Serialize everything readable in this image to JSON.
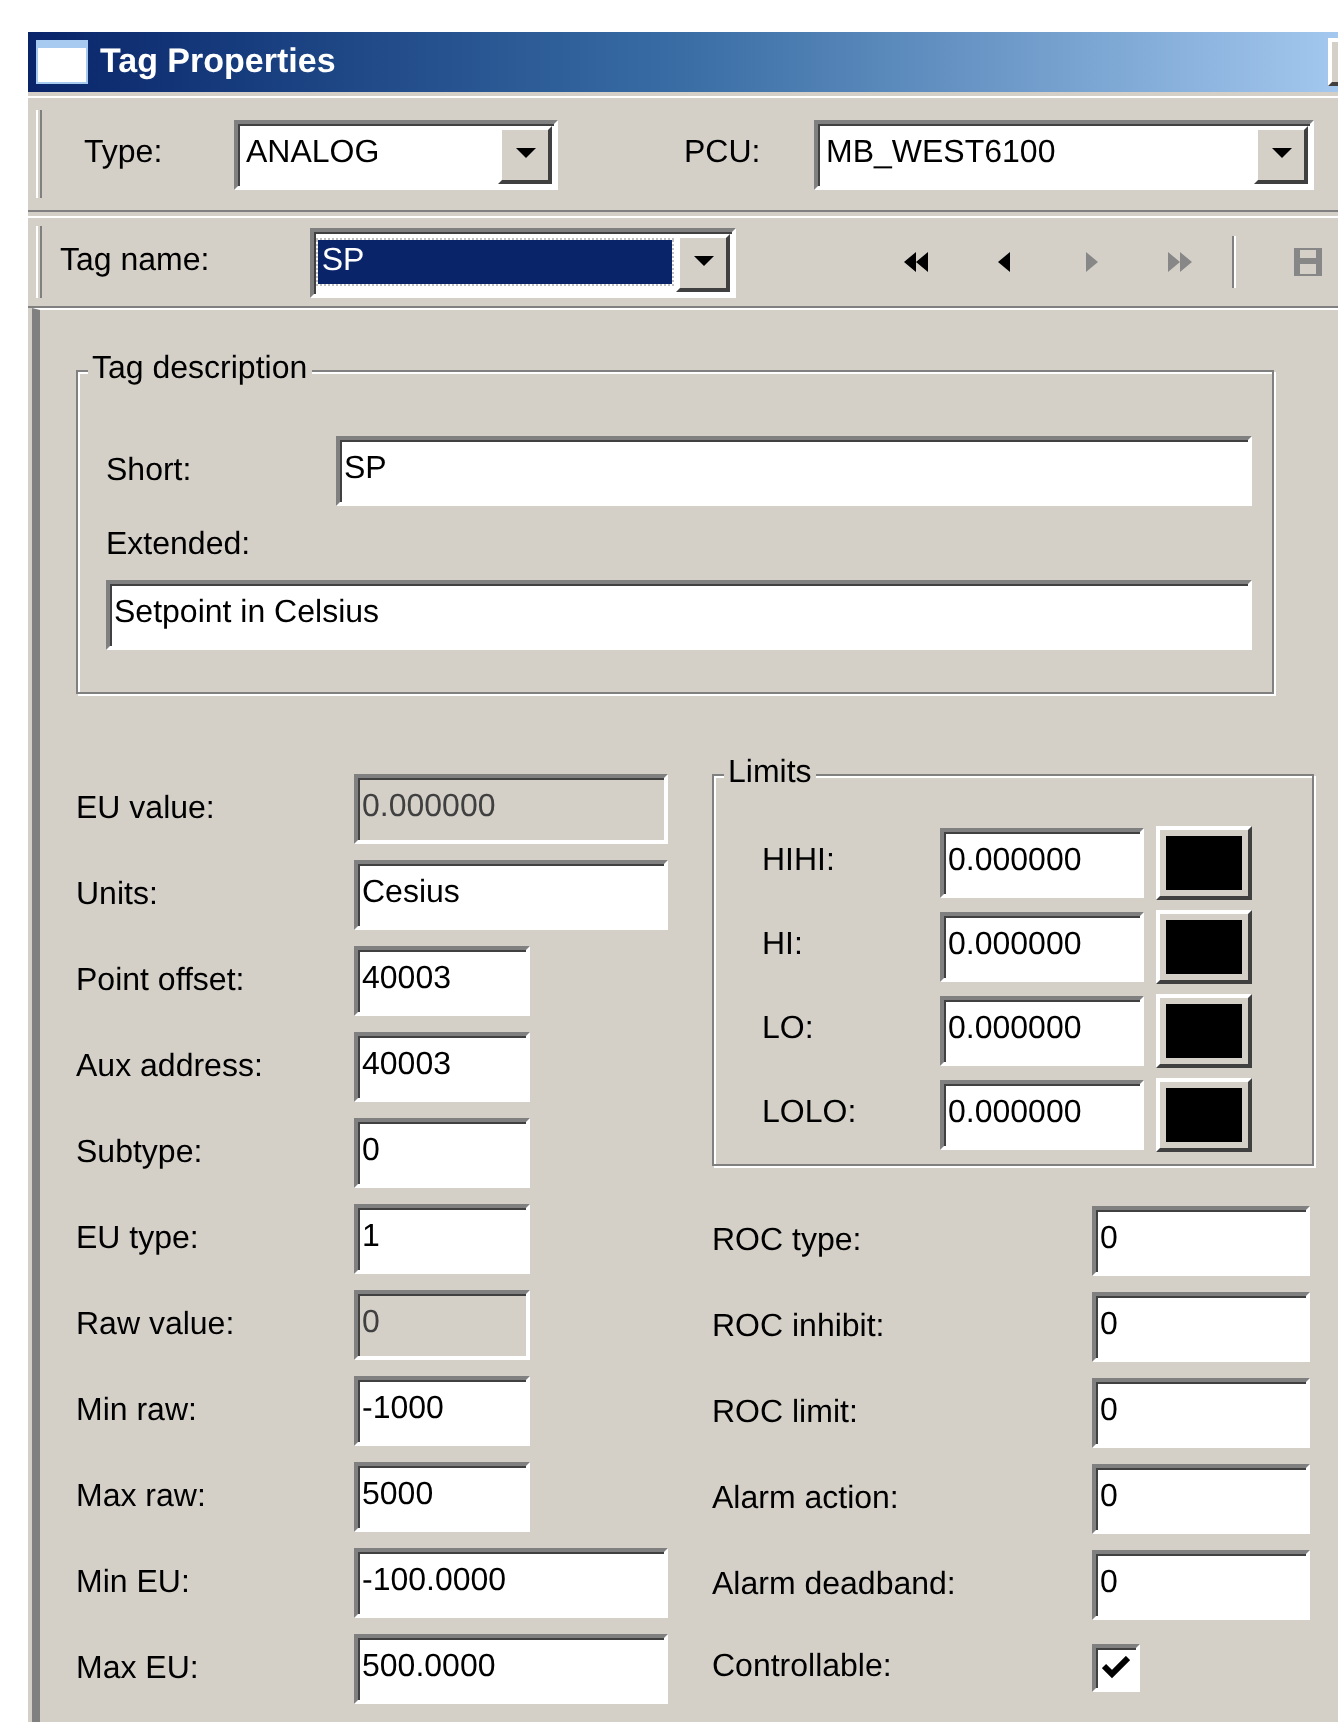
{
  "window": {
    "title": "Tag Properties"
  },
  "toolbar": {
    "type": {
      "label": "Type:",
      "value": "ANALOG"
    },
    "pcu": {
      "label": "PCU:",
      "value": "MB_WEST6100"
    }
  },
  "tag_bar": {
    "label": "Tag name:",
    "value": "SP",
    "nav": [
      {
        "kind": "first",
        "disabled": false
      },
      {
        "kind": "previous",
        "disabled": false
      },
      {
        "kind": "next",
        "disabled": true
      },
      {
        "kind": "last",
        "disabled": true
      },
      {
        "kind": "save",
        "disabled": true
      }
    ]
  },
  "tag_description": {
    "title": "Tag description",
    "short": {
      "label": "Short:",
      "value": "SP"
    },
    "extended": {
      "label": "Extended:",
      "value": "Setpoint in Celsius"
    }
  },
  "fields": [
    {
      "label": "EU value:",
      "value": "0.000000",
      "kind": "wide",
      "disabled": true
    },
    {
      "label": "Units:",
      "value": "Cesius",
      "kind": "wide",
      "disabled": false
    },
    {
      "label": "Point offset:",
      "value": "40003",
      "kind": "narrow",
      "disabled": false
    },
    {
      "label": "Aux address:",
      "value": "40003",
      "kind": "narrow",
      "disabled": false
    },
    {
      "label": "Subtype:",
      "value": "0",
      "kind": "narrow",
      "disabled": false
    },
    {
      "label": "EU type:",
      "value": "1",
      "kind": "narrow",
      "disabled": false
    },
    {
      "label": "Raw value:",
      "value": "0",
      "kind": "narrow",
      "disabled": true
    },
    {
      "label": "Min raw:",
      "value": "-1000",
      "kind": "narrow",
      "disabled": false
    },
    {
      "label": "Max raw:",
      "value": "5000",
      "kind": "narrow",
      "disabled": false
    },
    {
      "label": "Min EU:",
      "value": "-100.0000",
      "kind": "wide",
      "disabled": false
    },
    {
      "label": "Max EU:",
      "value": "500.0000",
      "kind": "wide",
      "disabled": false
    }
  ],
  "limits": {
    "title": "Limits",
    "rows": [
      {
        "label": "HIHI:",
        "value": "0.000000",
        "color": "#000000"
      },
      {
        "label": "HI:",
        "value": "0.000000",
        "color": "#000000"
      },
      {
        "label": "LO:",
        "value": "0.000000",
        "color": "#000000"
      },
      {
        "label": "LOLO:",
        "value": "0.000000",
        "color": "#000000"
      }
    ]
  },
  "alarm_fields": [
    {
      "label": "ROC type:",
      "value": "0"
    },
    {
      "label": "ROC inhibit:",
      "value": "0"
    },
    {
      "label": "ROC limit:",
      "value": "0"
    },
    {
      "label": "Alarm action:",
      "value": "0"
    },
    {
      "label": "Alarm deadband:",
      "value": "0"
    }
  ],
  "controllable": {
    "label": "Controllable:",
    "checked": true
  }
}
